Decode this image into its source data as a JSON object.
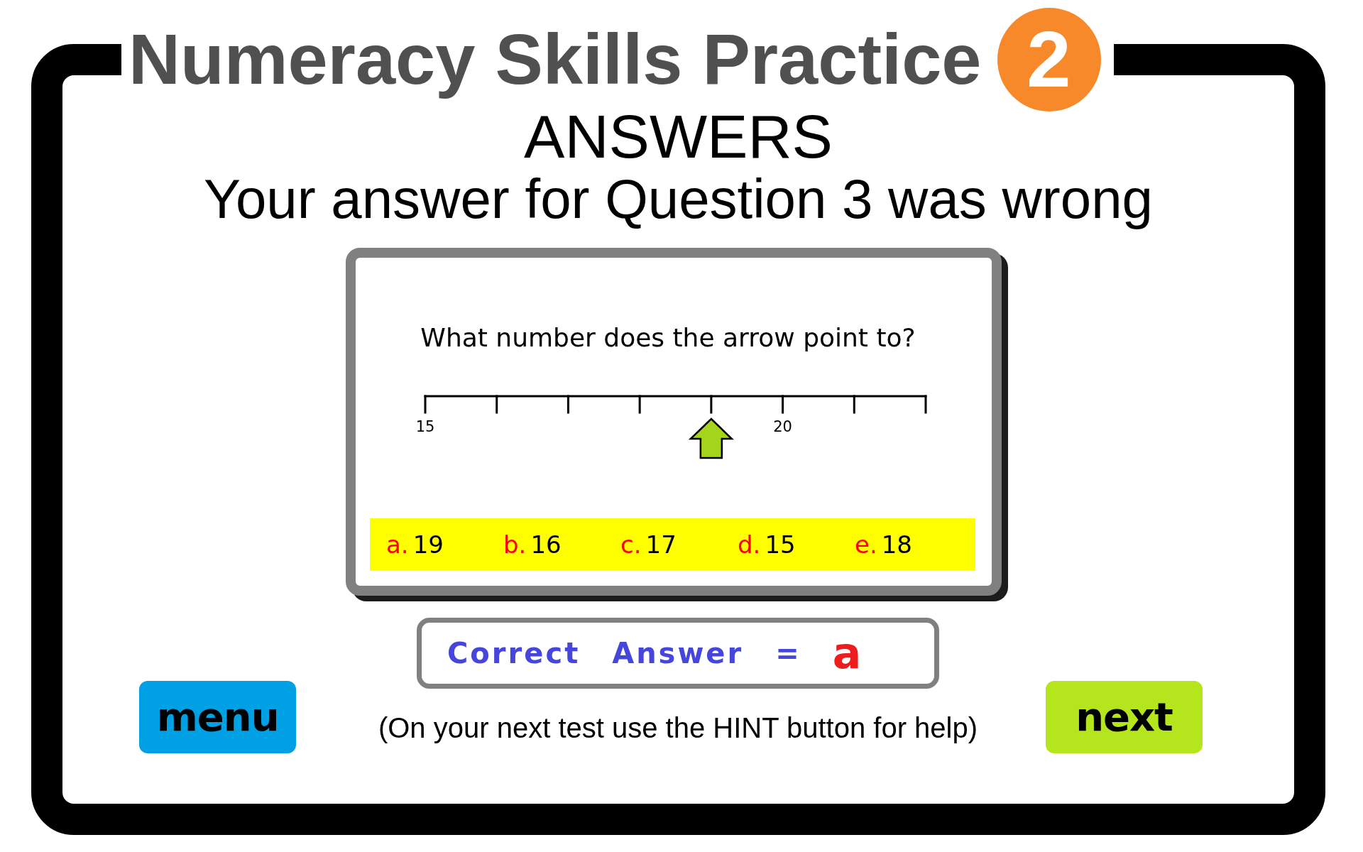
{
  "header": {
    "title": "Numeracy Skills Practice",
    "number": "2"
  },
  "heading": "ANSWERS",
  "result_message": "Your answer for Question 3 was wrong",
  "question_card": {
    "question": "What number does the arrow point to?",
    "number_line": {
      "ticks": [
        {
          "kind": "labeled",
          "label": "15",
          "pointed_at": false
        },
        {
          "kind": "plain",
          "pointed_at": false
        },
        {
          "kind": "plain",
          "pointed_at": false
        },
        {
          "kind": "plain",
          "pointed_at": false
        },
        {
          "kind": "plain",
          "pointed_at": true
        },
        {
          "kind": "labeled",
          "label": "20",
          "pointed_at": false
        },
        {
          "kind": "plain",
          "pointed_at": false
        },
        {
          "kind": "plain",
          "pointed_at": false
        }
      ]
    },
    "options": [
      {
        "letter": "a.",
        "value": "19"
      },
      {
        "letter": "b.",
        "value": "16"
      },
      {
        "letter": "c.",
        "value": "17"
      },
      {
        "letter": "d.",
        "value": "15"
      },
      {
        "letter": "e.",
        "value": "18"
      }
    ]
  },
  "correct_answer": {
    "label": "Correct Answer =",
    "value": "a"
  },
  "hint": "(On your next test use the HINT button for help)",
  "menu_button": {
    "label": "menu"
  },
  "next_button": {
    "label": "next"
  }
}
